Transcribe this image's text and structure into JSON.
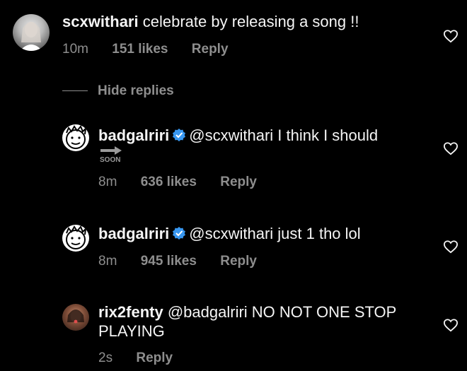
{
  "comments": [
    {
      "username": "scxwithari",
      "text": "celebrate by releasing a song !!",
      "time": "10m",
      "likes": "151 likes",
      "reply": "Reply"
    }
  ],
  "hide_replies": "Hide replies",
  "replies": [
    {
      "username": "badgalriri",
      "text": "@scxwithari I think I should",
      "sticker_text": "SOON",
      "time": "8m",
      "likes": "636 likes",
      "reply": "Reply"
    },
    {
      "username": "badgalriri",
      "text": "@scxwithari just 1 tho lol",
      "time": "8m",
      "likes": "945 likes",
      "reply": "Reply"
    },
    {
      "username": "rix2fenty",
      "text_line1": "@badgalriri NO NOT ONE STOP",
      "text_line2": "PLAYING",
      "time": "2s",
      "reply": "Reply"
    }
  ],
  "colors": {
    "background": "#000000",
    "text": "#f5f5f5",
    "secondary": "#8e8e8e",
    "verified": "#3897f0"
  }
}
